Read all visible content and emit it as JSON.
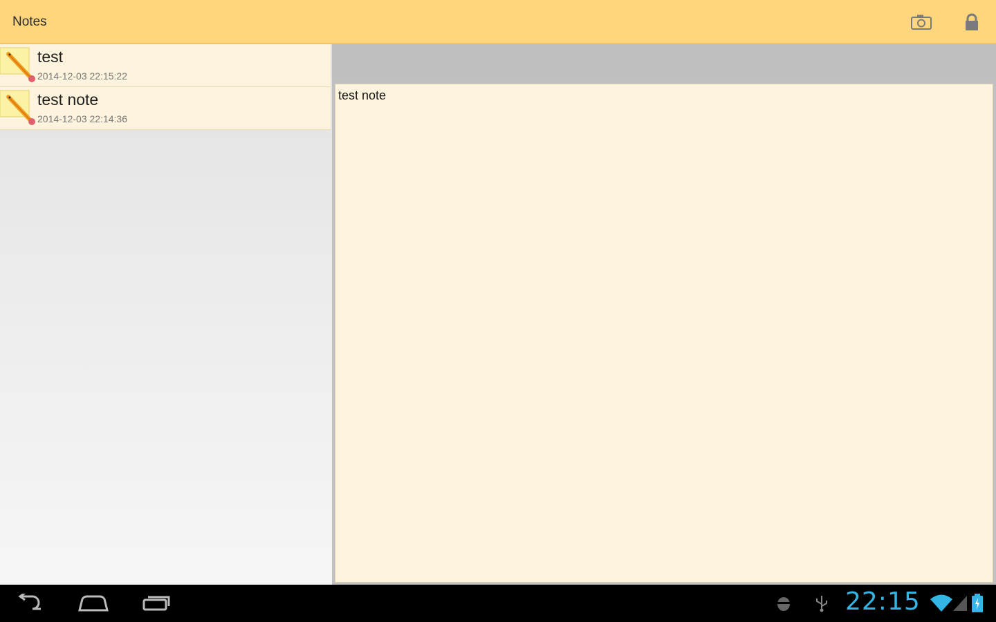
{
  "actionbar": {
    "title": "Notes",
    "icons": [
      "camera-icon",
      "lock-icon"
    ]
  },
  "notes": [
    {
      "title": "test",
      "date": "2014-12-03 22:15:22"
    },
    {
      "title": "test note",
      "date": "2014-12-03 22:14:36"
    }
  ],
  "editor": {
    "content": "test note"
  },
  "statusbar": {
    "time": "22:15",
    "icons": [
      "android-debug-icon",
      "usb-icon",
      "wifi-icon",
      "signal-icon",
      "battery-icon"
    ]
  },
  "colors": {
    "actionbar": "#ffd67c",
    "note_bg": "#fef3dc",
    "clock": "#33b5e5"
  }
}
